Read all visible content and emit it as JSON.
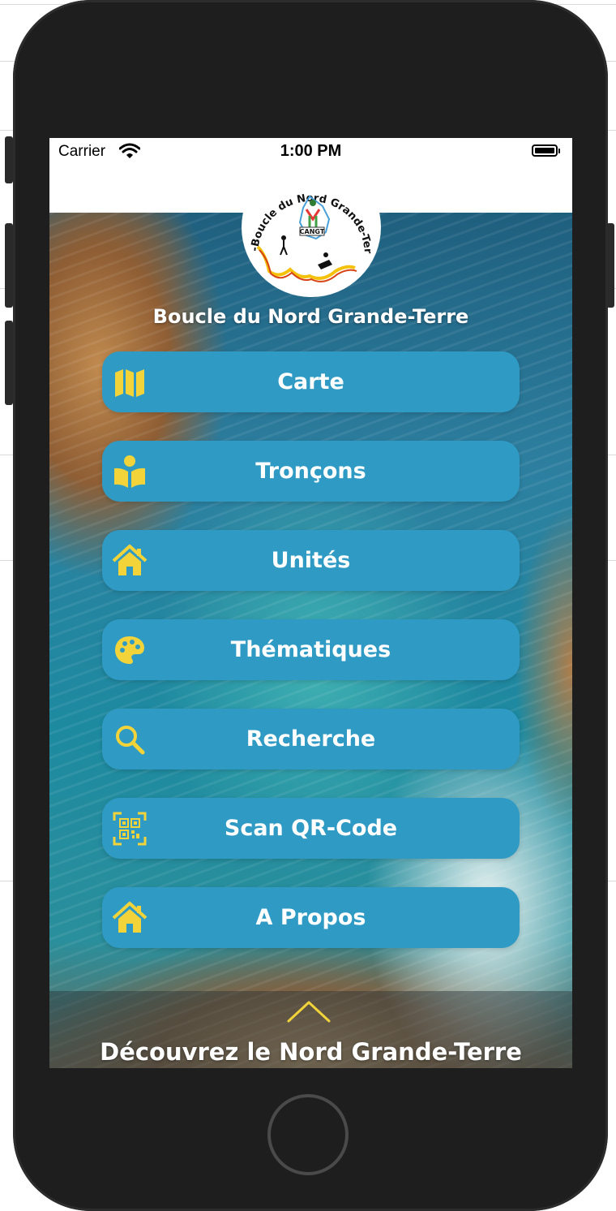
{
  "status_bar": {
    "carrier": "Carrier",
    "time": "1:00 PM"
  },
  "logo": {
    "ring_text": "-Boucle du Nord Grande-Terre-",
    "badge": "CANGT"
  },
  "app_title": "Boucle du Nord Grande-Terre",
  "menu": [
    {
      "label": "Carte",
      "icon": "map-icon"
    },
    {
      "label": "Tronçons",
      "icon": "book-reader-icon"
    },
    {
      "label": "Unités",
      "icon": "home-icon"
    },
    {
      "label": "Thématiques",
      "icon": "palette-icon"
    },
    {
      "label": "Recherche",
      "icon": "search-icon"
    },
    {
      "label": "Scan QR-Code",
      "icon": "qr-code-icon"
    },
    {
      "label": "A Propos",
      "icon": "home-icon"
    }
  ],
  "bottom_sheet": {
    "label": "Découvrez le Nord Grande-Terre",
    "icon": "chevron-up-icon"
  },
  "colors": {
    "button": "#2f9bc5",
    "icon_yellow": "#f2d43a",
    "text": "#ffffff"
  }
}
